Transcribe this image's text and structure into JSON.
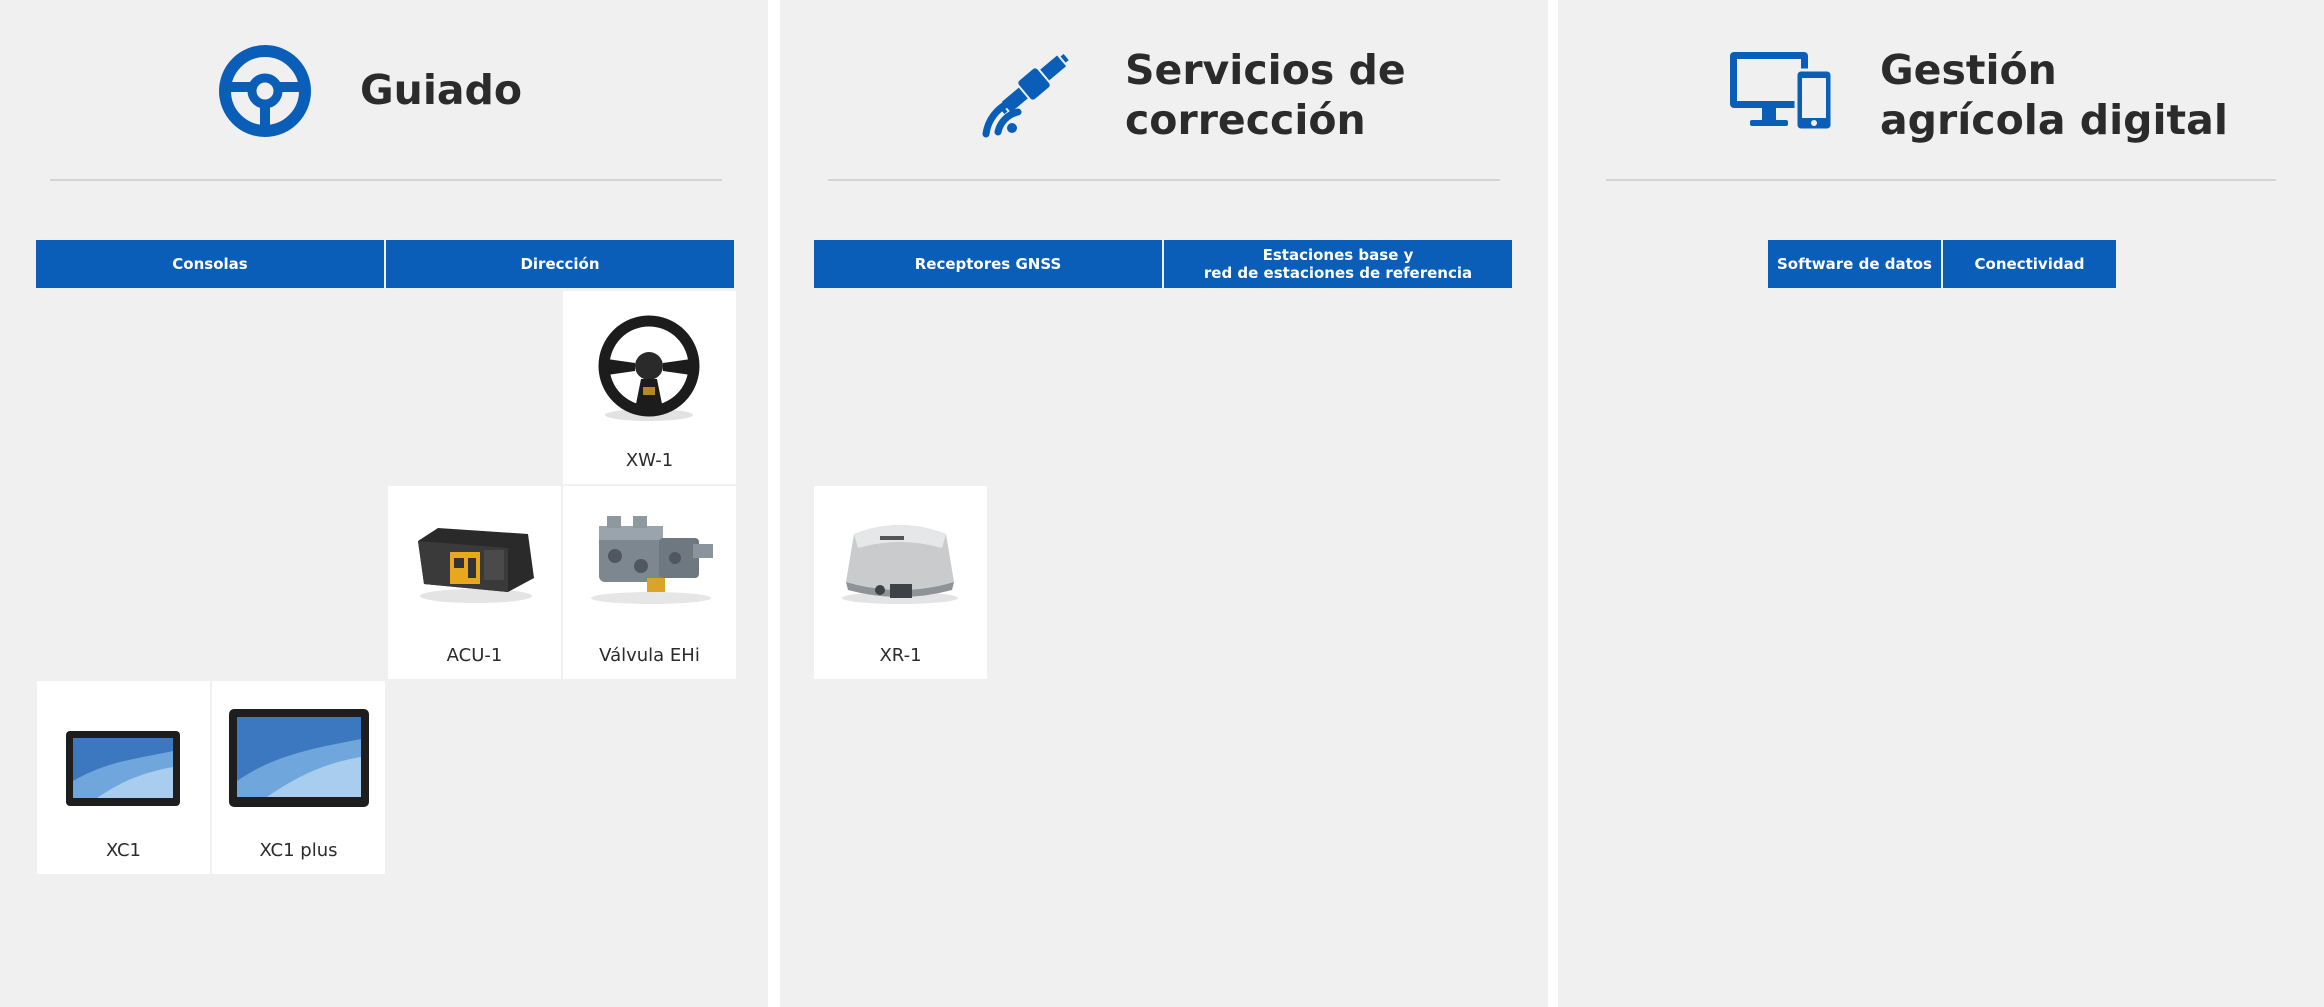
{
  "colors": {
    "accent": "#0a5eb8",
    "panel_bg": "#f0f0f0",
    "card_bg": "#ffffff",
    "title_text": "#2b2b2b"
  },
  "sections": [
    {
      "title": "Guiado",
      "icon": "steering-wheel-icon",
      "tabs": [
        "Consolas",
        "Dirección"
      ],
      "products": [
        {
          "name": "XW-1",
          "icon": "steering-wheel-product-icon"
        },
        {
          "name": "ACU-1",
          "icon": "control-unit-product-icon"
        },
        {
          "name": "Válvula EHi",
          "icon": "hydraulic-valve-product-icon"
        },
        {
          "name": "XC1",
          "icon": "console-product-icon"
        },
        {
          "name": "XC1 plus",
          "icon": "console-plus-product-icon"
        }
      ]
    },
    {
      "title": "Servicios de\ncorrección",
      "icon": "satellite-icon",
      "tabs": [
        "Receptores GNSS",
        "Estaciones base y\nred de estaciones de referencia"
      ],
      "products": [
        {
          "name": "XR-1",
          "icon": "gnss-receiver-product-icon"
        }
      ]
    },
    {
      "title": "Gestión\nagrícola digital",
      "icon": "monitor-phone-icon",
      "tabs": [
        "Software de datos",
        "Conectividad"
      ],
      "products": []
    }
  ]
}
